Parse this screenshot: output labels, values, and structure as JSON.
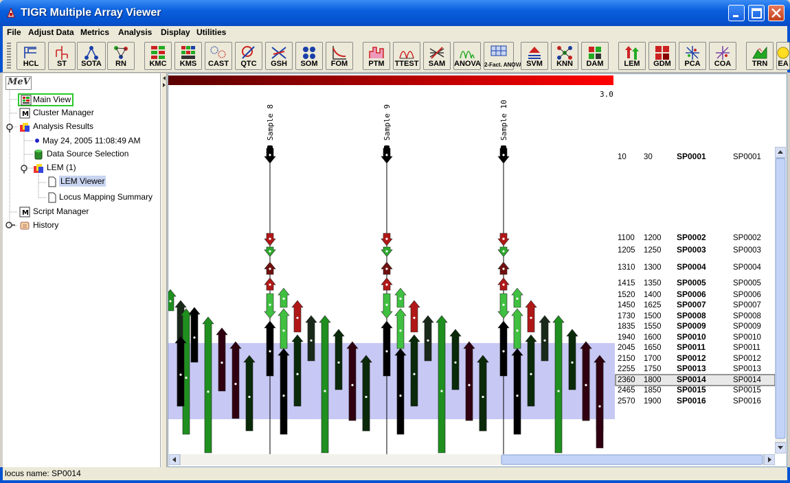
{
  "window": {
    "title": "TIGR Multiple Array Viewer"
  },
  "menu": [
    "File",
    "Adjust Data",
    "Metrics",
    "Analysis",
    "Display",
    "Utilities"
  ],
  "toolbar": [
    "HCL",
    "ST",
    "SOTA",
    "RN",
    "KMC",
    "KMS",
    "CAST",
    "QTC",
    "GSH",
    "SOM",
    "FOM",
    "PTM",
    "TTEST",
    "SAM",
    "ANOVA",
    "2-Fact. ANOVA",
    "SVM",
    "KNN",
    "DAM",
    "LEM",
    "GDM",
    "PCA",
    "COA",
    "TRN",
    "EA"
  ],
  "tree": {
    "logo": "MeV",
    "main_view": "Main View",
    "cluster_manager": "Cluster Manager",
    "analysis_results": "Analysis Results",
    "timestamp": "May 24, 2005 11:08:49 AM",
    "data_source": "Data Source Selection",
    "lem": "LEM (1)",
    "lem_viewer": "LEM Viewer",
    "locus_summary": "Locus Mapping Summary",
    "script_manager": "Script Manager",
    "history": "History"
  },
  "viewer": {
    "scale_max": "3.0",
    "samples": [
      "Sample 8",
      "Sample 9",
      "Sample 10"
    ],
    "selected_locus": "SP0014"
  },
  "loci": [
    {
      "start": "10",
      "end": "30",
      "name": "SP0001",
      "id": "SP0001"
    },
    {
      "start": "1100",
      "end": "1200",
      "name": "SP0002",
      "id": "SP0002"
    },
    {
      "start": "1205",
      "end": "1250",
      "name": "SP0003",
      "id": "SP0003"
    },
    {
      "start": "1310",
      "end": "1300",
      "name": "SP0004",
      "id": "SP0004"
    },
    {
      "start": "1415",
      "end": "1350",
      "name": "SP0005",
      "id": "SP0005"
    },
    {
      "start": "1520",
      "end": "1400",
      "name": "SP0006",
      "id": "SP0006"
    },
    {
      "start": "1450",
      "end": "1625",
      "name": "SP0007",
      "id": "SP0007"
    },
    {
      "start": "1730",
      "end": "1500",
      "name": "SP0008",
      "id": "SP0008"
    },
    {
      "start": "1835",
      "end": "1550",
      "name": "SP0009",
      "id": "SP0009"
    },
    {
      "start": "1940",
      "end": "1600",
      "name": "SP0010",
      "id": "SP0010"
    },
    {
      "start": "2045",
      "end": "1650",
      "name": "SP0011",
      "id": "SP0011"
    },
    {
      "start": "2150",
      "end": "1700",
      "name": "SP0012",
      "id": "SP0012"
    },
    {
      "start": "2255",
      "end": "1750",
      "name": "SP0013",
      "id": "SP0013"
    },
    {
      "start": "2360",
      "end": "1800",
      "name": "SP0014",
      "id": "SP0014"
    },
    {
      "start": "2465",
      "end": "1850",
      "name": "SP0015",
      "id": "SP0015"
    },
    {
      "start": "2570",
      "end": "1900",
      "name": "SP0016",
      "id": "SP0016"
    }
  ],
  "status": {
    "text": "locus name: SP0014"
  }
}
